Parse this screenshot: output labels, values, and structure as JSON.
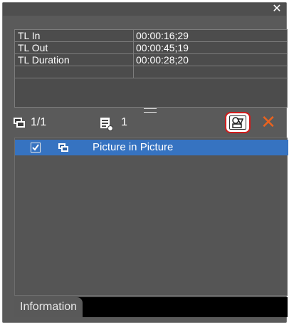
{
  "window": {
    "close_icon": "close-icon"
  },
  "info": {
    "rows": [
      {
        "label": "TL In",
        "value": "00:00:16;29"
      },
      {
        "label": "TL Out",
        "value": "00:00:45;19"
      },
      {
        "label": "TL Duration",
        "value": "00:00:28;20"
      }
    ]
  },
  "toolbar": {
    "layers_count": "1/1",
    "clips_count": "1"
  },
  "effects_list": {
    "items": [
      {
        "label": "Picture in Picture",
        "checked": true,
        "selected": true
      }
    ]
  },
  "tabs": [
    {
      "label": "Information",
      "active": true
    }
  ],
  "colors": {
    "panel_bg": "#5a5a5a",
    "selection": "#3673c1",
    "delete_accent": "#e9631f",
    "highlight_frame": "#d01c1c"
  }
}
